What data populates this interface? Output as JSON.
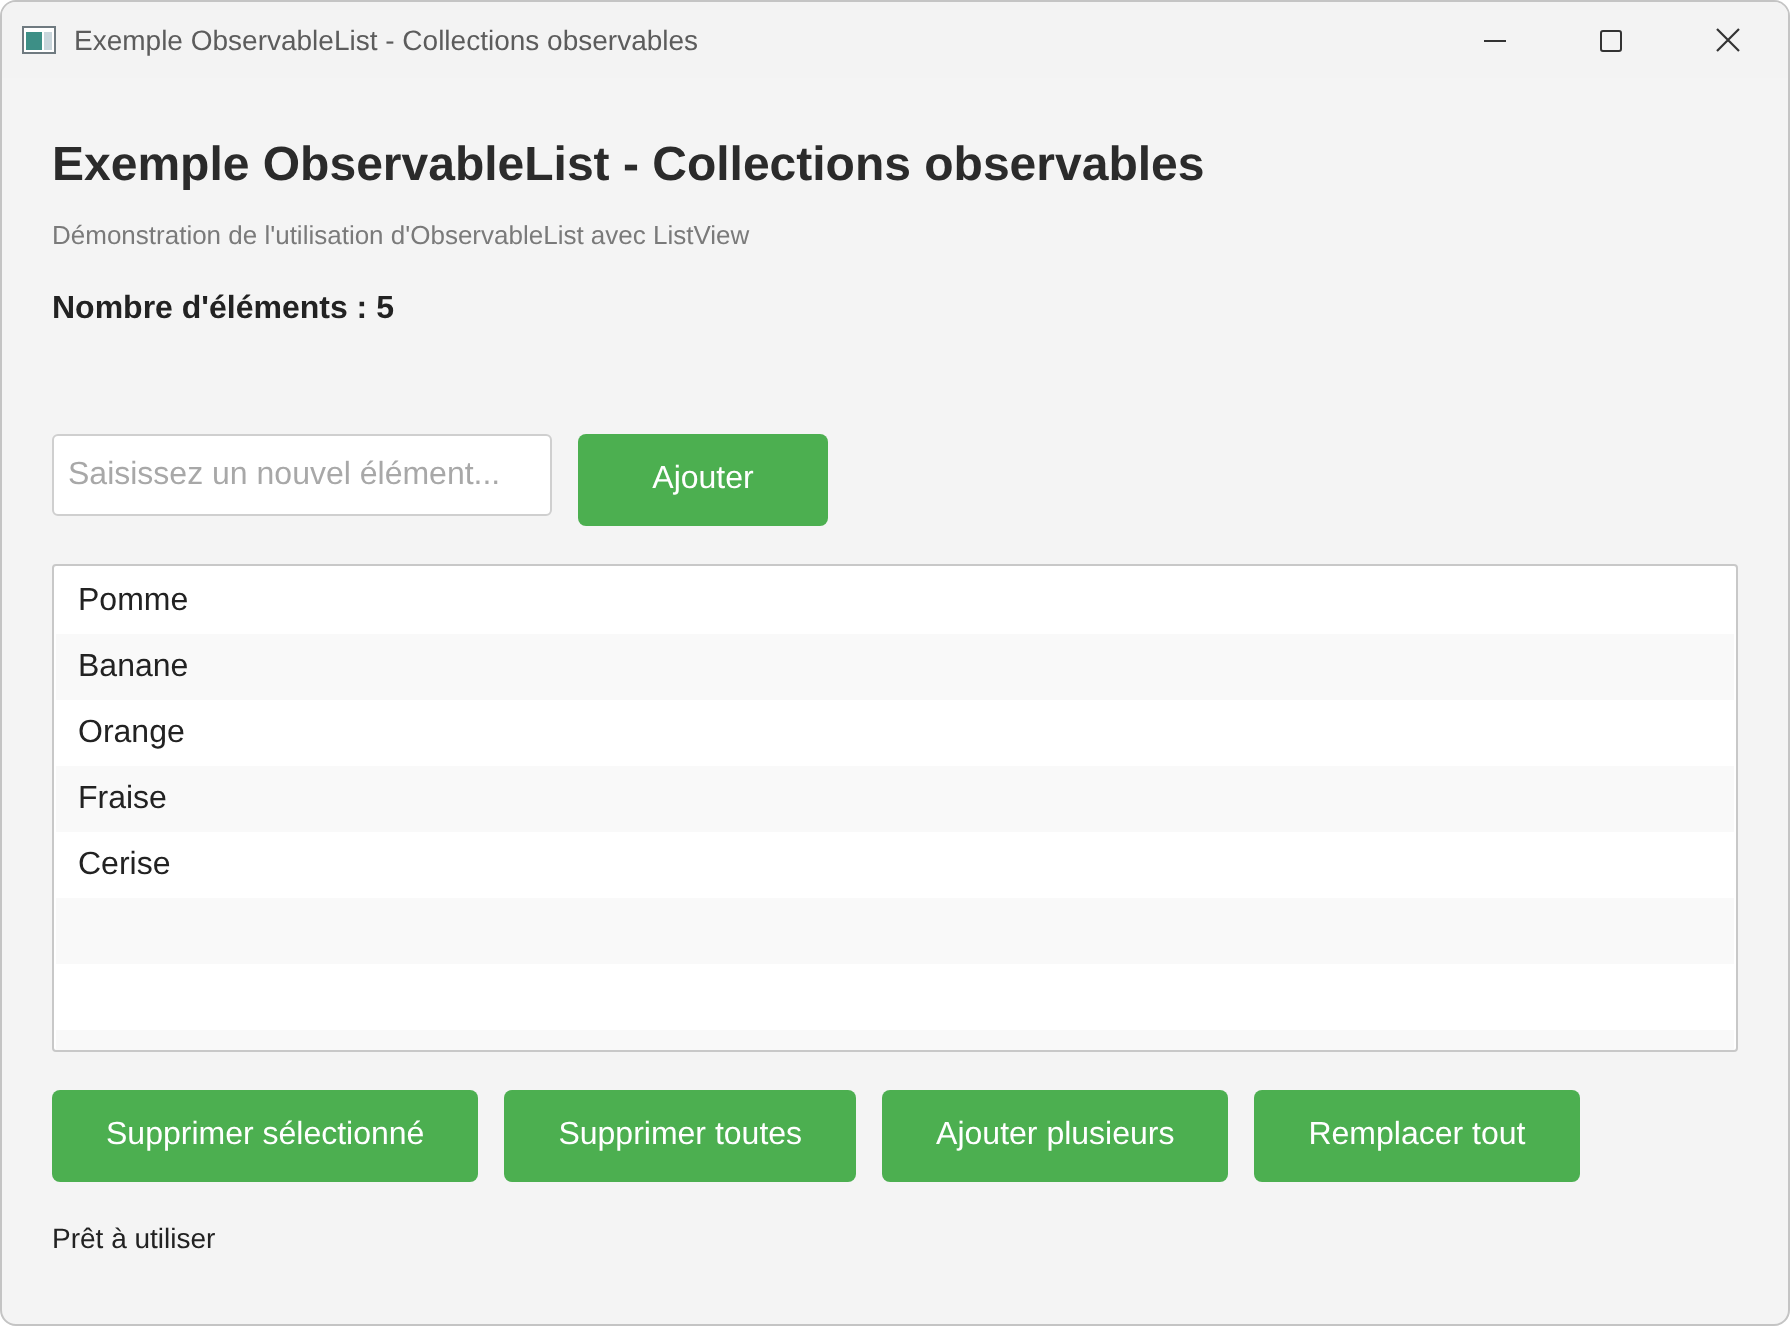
{
  "window": {
    "title": "Exemple ObservableList - Collections observables"
  },
  "heading": "Exemple ObservableList - Collections observables",
  "subtitle": "Démonstration de l'utilisation d'ObservableList avec ListView",
  "count_label": "Nombre d'éléments : 5",
  "new_item_field": {
    "placeholder": "Saisissez un nouvel élément..."
  },
  "add_button": "Ajouter",
  "list": {
    "items": [
      {
        "label": "Pomme",
        "selected": false
      },
      {
        "label": "Banane",
        "selected": false
      },
      {
        "label": "Orange",
        "selected": false
      },
      {
        "label": "Fraise",
        "selected": false
      },
      {
        "label": "Cerise",
        "selected": false
      }
    ]
  },
  "action_buttons": [
    "Supprimer sélectionné",
    "Supprimer toutes",
    "Ajouter plusieurs",
    "Remplacer tout"
  ],
  "status_bar": "Prêt à utiliser"
}
